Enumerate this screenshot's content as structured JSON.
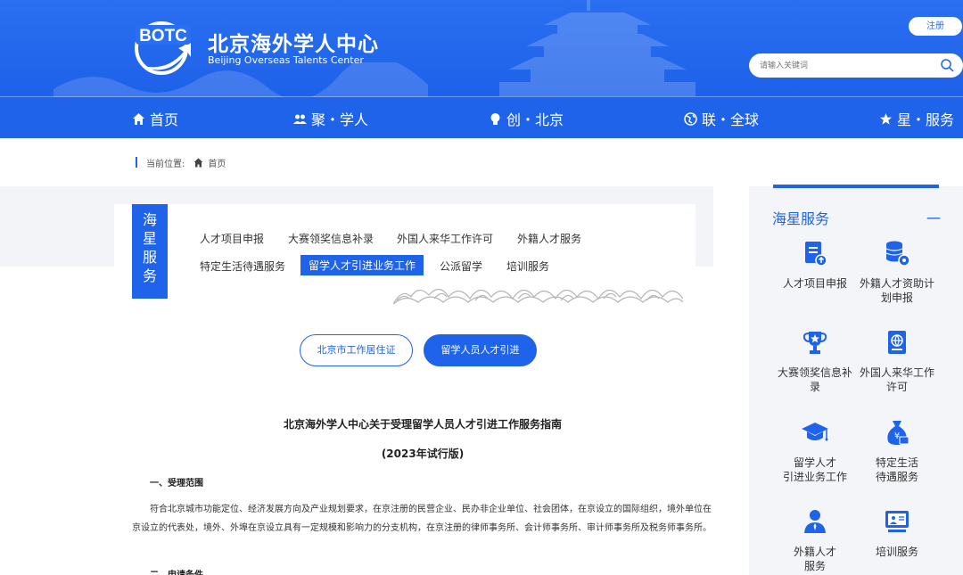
{
  "header": {
    "title": "北京海外学人中心",
    "subtitle": "Beijing Overseas Talents Center",
    "logo_text": "BOTC",
    "register_label": "注册",
    "search_placeholder": "请输入关键词"
  },
  "nav": {
    "items": [
      {
        "label": "首页",
        "icon": "home-icon"
      },
      {
        "label": "聚・学人",
        "icon": "users-icon"
      },
      {
        "label": "创・北京",
        "icon": "lightbulb-icon"
      },
      {
        "label": "联・全球",
        "icon": "globe-icon"
      },
      {
        "label": "星・服务",
        "icon": "star-icon"
      }
    ]
  },
  "breadcrumb": {
    "prefix": "当前位置:",
    "home": "首页"
  },
  "category": {
    "tab_chars": [
      "海",
      "星",
      "服",
      "务"
    ],
    "links_row1": [
      "人才项目申报",
      "大赛领奖信息补录",
      "外国人来华工作许可",
      "外籍人才服务"
    ],
    "links_row2": [
      "特定生活待遇服务",
      "留学人才引进业务工作",
      "公派留学",
      "培训服务"
    ],
    "active": "留学人才引进业务工作"
  },
  "pills": {
    "first": "北京市工作居住证",
    "second": "留学人员人才引进"
  },
  "document": {
    "title": "北京海外学人中心关于受理留学人员人才引进工作服务指南",
    "subtitle": "(2023年试行版)",
    "section1": "一、受理范围",
    "section1_text": "符合北京城市功能定位、经济发展方向及产业规划要求，在京注册的民营企业、民办非企业单位、社会团体，在京设立的国际组织，境外单位在京设立的代表处，境外、外埠在京设立具有一定规模和影响力的分支机构，在京注册的律师事务所、会计师事务所、审计师事务所及税务师事务所。",
    "section2": "二、申请条件"
  },
  "side": {
    "title": "海星服务",
    "collapse": "一",
    "items": [
      {
        "label": "人才项目申报",
        "icon": "document-upload-icon"
      },
      {
        "label": "外籍人才资助计划申报",
        "icon": "coins-gear-icon"
      },
      {
        "label": "大赛领奖信息补录",
        "icon": "trophy-icon"
      },
      {
        "label": "外国人来华工作许可",
        "icon": "passport-icon"
      },
      {
        "label": "留学人才\n引进业务工作",
        "icon": "graduation-cap-icon"
      },
      {
        "label": "特定生活\n待遇服务",
        "icon": "money-bag-icon"
      },
      {
        "label": "外籍人才\n服务",
        "icon": "person-icon"
      },
      {
        "label": "培训服务",
        "icon": "presentation-icon"
      }
    ]
  },
  "colors": {
    "primary": "#1f63ea",
    "header_bg": "#2a6ff0",
    "panel_bg": "#f4f5f8"
  }
}
